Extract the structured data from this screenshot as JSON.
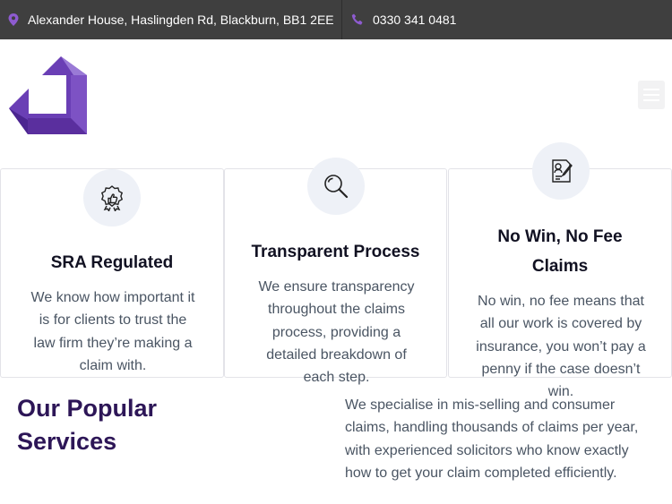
{
  "topbar": {
    "address": "Alexander House, Haslingden Rd, Blackburn, BB1 2EE",
    "phone": "0330 341 0481"
  },
  "header": {
    "logo_icon": "company-logo",
    "menu_icon": "hamburger-menu-icon"
  },
  "features": [
    {
      "icon": "certified-badge-icon",
      "title": "SRA Regulated",
      "text_lines": [
        "We know how important it",
        "is for clients to trust the",
        "law firm they’re making a",
        "claim with."
      ]
    },
    {
      "icon": "magnifier-icon",
      "title": "Transparent Process",
      "text_lines": [
        "We ensure transparency",
        "throughout the claims",
        "process, providing a",
        "detailed breakdown of",
        "each step."
      ]
    },
    {
      "icon": "contract-document-icon",
      "title_lines": [
        "No Win, No Fee",
        "Claims"
      ],
      "text_lines": [
        "No win, no fee means that",
        "all our work is covered by",
        "insurance, you won’t pay a",
        "penny if the case doesn’t",
        "win."
      ]
    }
  ],
  "services": {
    "title_lines": [
      "Our Popular",
      "Services"
    ],
    "description_lines": [
      "We specialise in mis-selling and consumer",
      "claims, handling thousands of claims per year,",
      "with experienced solicitors who know exactly",
      "how to get your claim completed efficiently."
    ]
  },
  "colors": {
    "topbar_bg": "#3f3f3f",
    "accent_purple": "#8e5bd0",
    "heading_purple": "#2d1657",
    "icon_circle_bg": "#eef1f7"
  }
}
